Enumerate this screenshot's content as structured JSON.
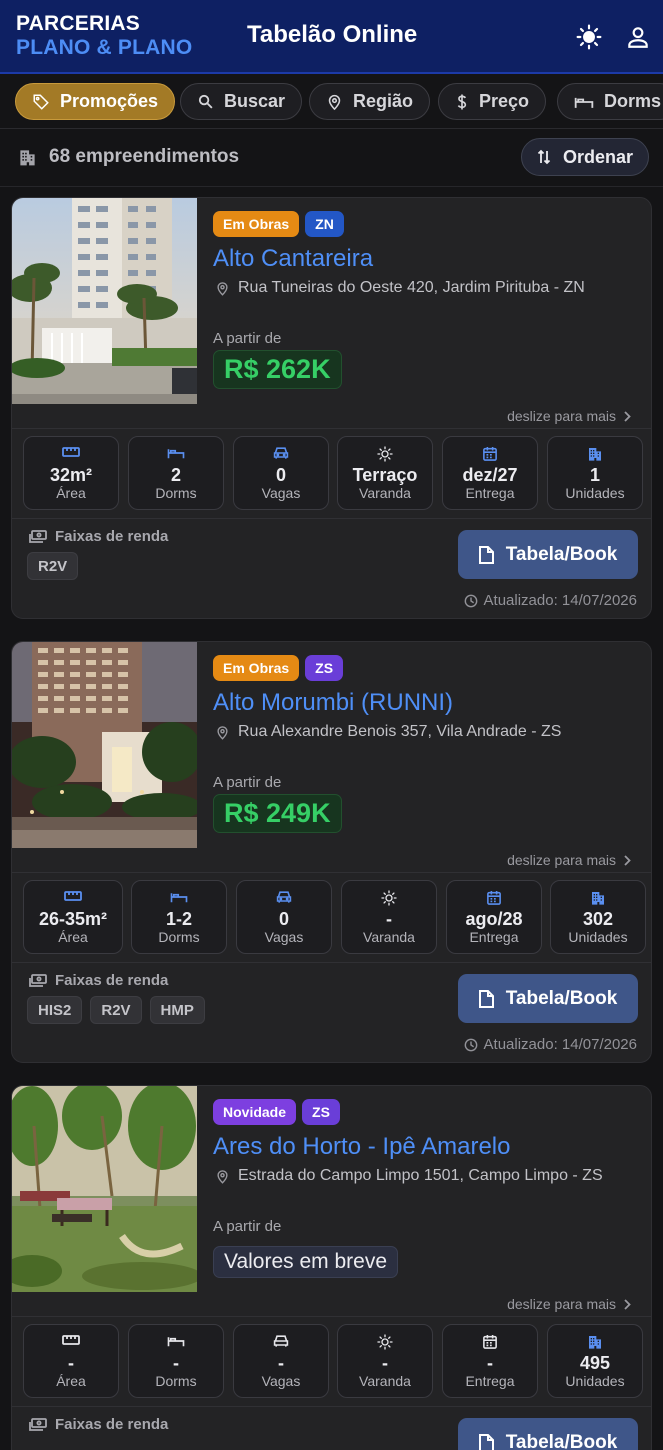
{
  "header": {
    "brand_line1": "PARCERIAS",
    "brand_line2": "PLANO & PLANO",
    "title": "Tabelão Online",
    "theme_icon": "sun-icon",
    "user_icon": "user-icon"
  },
  "filters": [
    {
      "label": "Promoções",
      "icon": "tag-icon",
      "active": true
    },
    {
      "label": "Buscar",
      "icon": "search-icon",
      "active": false
    },
    {
      "label": "Região",
      "icon": "map-pin-icon",
      "active": false
    },
    {
      "label": "Preço",
      "icon": "dollar-icon",
      "active": false
    },
    {
      "label": "Dorms",
      "icon": "bed-icon",
      "active": false
    }
  ],
  "summary": {
    "count_text": "68 empreendimentos",
    "sort_label": "Ordenar"
  },
  "colors": {
    "header_bg": "#0e2063",
    "accent_blue": "#4f8ff7",
    "active_chip": "#a37a26",
    "price_green": "#36cf66",
    "badge_obras": "#e58a14",
    "badge_novidade": "#7d3fe0"
  },
  "cards": [
    {
      "status": "Em Obras",
      "region": "ZN",
      "name": "Alto Cantareira",
      "address": "Rua Tuneiras do Oeste 420, Jardim Pirituba - ZN",
      "price_prefix": "A partir de",
      "price": "R$ 262K",
      "swipe_hint": "deslize para mais",
      "stats": [
        {
          "value": "32m²",
          "label": "Área",
          "icon": "ruler-icon"
        },
        {
          "value": "2",
          "label": "Dorms",
          "icon": "bed-icon"
        },
        {
          "value": "0",
          "label": "Vagas",
          "icon": "car-icon"
        },
        {
          "value": "Terraço",
          "label": "Varanda",
          "icon": "sun-icon"
        },
        {
          "value": "dez/27",
          "label": "Entrega",
          "icon": "calendar-icon"
        },
        {
          "value": "1",
          "label": "Unidades",
          "icon": "building-icon"
        }
      ],
      "faixas_label": "Faixas de renda",
      "faixas": [
        "R2V"
      ],
      "book_label": "Tabela/Book",
      "updated": "Atualizado: 14/07/2026"
    },
    {
      "status": "Em Obras",
      "region": "ZS",
      "name": "Alto Morumbi (RUNNI)",
      "address": "Rua Alexandre Benois 357, Vila Andrade - ZS",
      "price_prefix": "A partir de",
      "price": "R$ 249K",
      "swipe_hint": "deslize para mais",
      "stats": [
        {
          "value": "26-35m²",
          "label": "Área",
          "icon": "ruler-icon"
        },
        {
          "value": "1-2",
          "label": "Dorms",
          "icon": "bed-icon"
        },
        {
          "value": "0",
          "label": "Vagas",
          "icon": "car-icon"
        },
        {
          "value": "-",
          "label": "Varanda",
          "icon": "sun-icon"
        },
        {
          "value": "ago/28",
          "label": "Entrega",
          "icon": "calendar-icon"
        },
        {
          "value": "302",
          "label": "Unidades",
          "icon": "building-icon"
        }
      ],
      "faixas_label": "Faixas de renda",
      "faixas": [
        "HIS2",
        "R2V",
        "HMP"
      ],
      "book_label": "Tabela/Book",
      "updated": "Atualizado: 14/07/2026"
    },
    {
      "status": "Novidade",
      "region": "ZS",
      "name": "Ares do Horto - Ipê Amarelo",
      "address": "Estrada do Campo Limpo 1501, Campo Limpo - ZS",
      "price_prefix": "A partir de",
      "price": "Valores em breve",
      "swipe_hint": "deslize para mais",
      "stats": [
        {
          "value": "-",
          "label": "Área",
          "icon": "ruler-icon"
        },
        {
          "value": "-",
          "label": "Dorms",
          "icon": "bed-icon"
        },
        {
          "value": "-",
          "label": "Vagas",
          "icon": "car-icon"
        },
        {
          "value": "-",
          "label": "Varanda",
          "icon": "sun-icon"
        },
        {
          "value": "-",
          "label": "Entrega",
          "icon": "calendar-icon"
        },
        {
          "value": "495",
          "label": "Unidades",
          "icon": "building-icon"
        }
      ],
      "faixas_label": "Faixas de renda",
      "book_label": "Tabela/Book"
    }
  ]
}
